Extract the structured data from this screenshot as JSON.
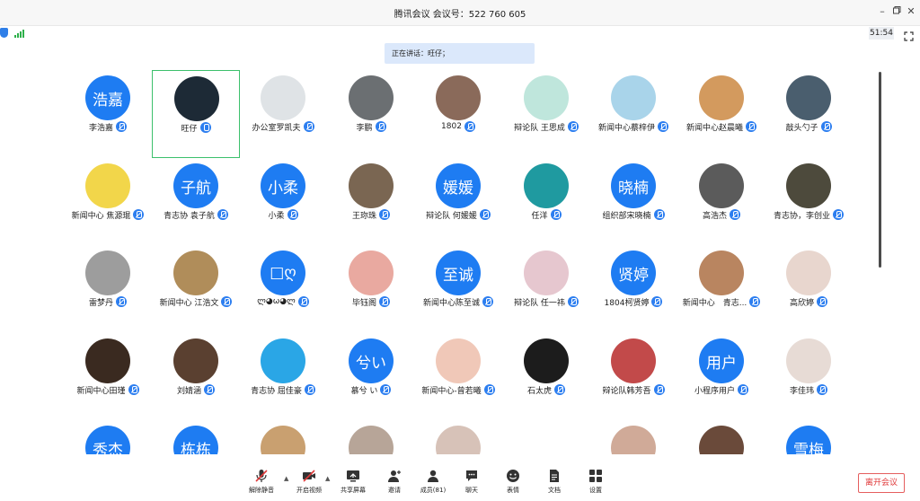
{
  "window": {
    "title": "腾讯会议 会议号：522 760 605"
  },
  "status": {
    "timer": "51:54",
    "shield_icon": "shield-icon",
    "signal_icon": "signal-icon",
    "colors": {
      "signal": "#2db04a",
      "accent": "#1e7cf2"
    }
  },
  "speaking": {
    "text": "正在讲话：旺仔；"
  },
  "participants": [
    {
      "name": "李浩嘉",
      "avatar_text": "浩嘉",
      "avatar_color": "#1e7cf2",
      "mic": "muted"
    },
    {
      "name": "旺仔",
      "avatar_text": "",
      "avatar_color": "#1d2a36",
      "mic": "on",
      "active": true
    },
    {
      "name": "办公室罗凯夫",
      "avatar_text": "",
      "avatar_color": "#dfe3e6",
      "mic": "muted"
    },
    {
      "name": "李鹏",
      "avatar_text": "",
      "avatar_color": "#6b6f72",
      "mic": "muted"
    },
    {
      "name": "1802",
      "avatar_text": "",
      "avatar_color": "#8a6a5a",
      "mic": "muted"
    },
    {
      "name": "辩论队 王思成",
      "avatar_text": "",
      "avatar_color": "#bfe6dc",
      "mic": "muted"
    },
    {
      "name": "新闻中心蔡梓伊",
      "avatar_text": "",
      "avatar_color": "#a9d4ea",
      "mic": "muted"
    },
    {
      "name": "新闻中心赵晨曦",
      "avatar_text": "",
      "avatar_color": "#d39a5e",
      "mic": "muted"
    },
    {
      "name": "敲头勺子",
      "avatar_text": "",
      "avatar_color": "#4a5e6e",
      "mic": "muted"
    },
    {
      "name": "新闻中心 焦源琨",
      "avatar_text": "",
      "avatar_color": "#f2d64a",
      "mic": "muted"
    },
    {
      "name": "青志协 袁子航",
      "avatar_text": "子航",
      "avatar_color": "#1e7cf2",
      "mic": "muted"
    },
    {
      "name": "小柔",
      "avatar_text": "小柔",
      "avatar_color": "#1e7cf2",
      "mic": "muted"
    },
    {
      "name": "王珎珠",
      "avatar_text": "",
      "avatar_color": "#7a6652",
      "mic": "muted"
    },
    {
      "name": "辩论队 何媛媛",
      "avatar_text": "媛媛",
      "avatar_color": "#1e7cf2",
      "mic": "muted"
    },
    {
      "name": "任洋",
      "avatar_text": "",
      "avatar_color": "#1f9aa0",
      "mic": "muted"
    },
    {
      "name": "组织部宋晓楠",
      "avatar_text": "晓楠",
      "avatar_color": "#1e7cf2",
      "mic": "muted"
    },
    {
      "name": "高浩杰",
      "avatar_text": "",
      "avatar_color": "#5b5b5b",
      "mic": "muted"
    },
    {
      "name": "青志协，李创业",
      "avatar_text": "",
      "avatar_color": "#4d4a3c",
      "mic": "muted"
    },
    {
      "name": "雷梦丹",
      "avatar_text": "",
      "avatar_color": "#9d9d9d",
      "mic": "muted"
    },
    {
      "name": "新闻中心 江浩文",
      "avatar_text": "",
      "avatar_color": "#b08d5a",
      "mic": "muted"
    },
    {
      "name": "ლ◕ω◕ლ",
      "avatar_text": "□ღ",
      "avatar_color": "#1e7cf2",
      "mic": "muted"
    },
    {
      "name": "毕钰阁",
      "avatar_text": "",
      "avatar_color": "#e9a9a0",
      "mic": "muted"
    },
    {
      "name": "新闻中心陈至诚",
      "avatar_text": "至诚",
      "avatar_color": "#1e7cf2",
      "mic": "muted"
    },
    {
      "name": "辩论队 任一祎",
      "avatar_text": "",
      "avatar_color": "#e6c7cf",
      "mic": "muted"
    },
    {
      "name": "1804柯贤婷",
      "avatar_text": "贤婷",
      "avatar_color": "#1e7cf2",
      "mic": "muted"
    },
    {
      "name": "新闻中心　青志...",
      "avatar_text": "",
      "avatar_color": "#b98560",
      "mic": "muted"
    },
    {
      "name": "高欣婷",
      "avatar_text": "",
      "avatar_color": "#e8d6ce",
      "mic": "muted"
    },
    {
      "name": "新闻中心田瑾",
      "avatar_text": "",
      "avatar_color": "#3a2a20",
      "mic": "muted"
    },
    {
      "name": "刘婧涵",
      "avatar_text": "",
      "avatar_color": "#5a4030",
      "mic": "muted"
    },
    {
      "name": "青志协 屈佳豪",
      "avatar_text": "",
      "avatar_color": "#2aa6e6",
      "mic": "muted"
    },
    {
      "name": "慕兮 い",
      "avatar_text": "兮い",
      "avatar_color": "#1e7cf2",
      "mic": "muted"
    },
    {
      "name": "新闻中心-曾若曦",
      "avatar_text": "",
      "avatar_color": "#f0c8b8",
      "mic": "muted"
    },
    {
      "name": "石太虎",
      "avatar_text": "",
      "avatar_color": "#1c1c1c",
      "mic": "muted"
    },
    {
      "name": "辩论队韩芳吾",
      "avatar_text": "",
      "avatar_color": "#c24a4a",
      "mic": "muted"
    },
    {
      "name": "小程序用户",
      "avatar_text": "用户",
      "avatar_color": "#1e7cf2",
      "mic": "muted"
    },
    {
      "name": "李佳玮",
      "avatar_text": "",
      "avatar_color": "#e7dbd5",
      "mic": "muted"
    },
    {
      "name": "",
      "avatar_text": "秀杰",
      "avatar_color": "#1e7cf2",
      "mic": "none"
    },
    {
      "name": "",
      "avatar_text": "栋栋",
      "avatar_color": "#1e7cf2",
      "mic": "none"
    },
    {
      "name": "",
      "avatar_text": "",
      "avatar_color": "#c9a070",
      "mic": "none"
    },
    {
      "name": "",
      "avatar_text": "",
      "avatar_color": "#b7a598",
      "mic": "none"
    },
    {
      "name": "",
      "avatar_text": "",
      "avatar_color": "#d7c2b8",
      "mic": "none"
    },
    {
      "name": "",
      "avatar_text": "",
      "avatar_color": "#ffffff",
      "mic": "none"
    },
    {
      "name": "",
      "avatar_text": "",
      "avatar_color": "#d0aa98",
      "mic": "none"
    },
    {
      "name": "",
      "avatar_text": "",
      "avatar_color": "#6a4a3a",
      "mic": "none"
    },
    {
      "name": "",
      "avatar_text": "雪梅",
      "avatar_color": "#1e7cf2",
      "mic": "none"
    }
  ],
  "toolbar": {
    "unmute": "解除静音",
    "start_video": "开启视频",
    "share_screen": "共享屏幕",
    "invite": "邀请",
    "members": "成员(81)",
    "chat": "聊天",
    "reactions": "表情",
    "docs": "文档",
    "settings": "设置",
    "leave": "离开会议"
  }
}
